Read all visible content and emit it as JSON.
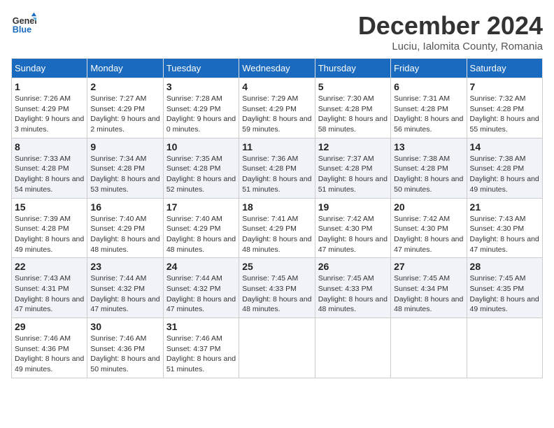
{
  "logo": {
    "line1": "General",
    "line2": "Blue"
  },
  "title": "December 2024",
  "subtitle": "Luciu, Ialomita County, Romania",
  "weekdays": [
    "Sunday",
    "Monday",
    "Tuesday",
    "Wednesday",
    "Thursday",
    "Friday",
    "Saturday"
  ],
  "weeks": [
    [
      {
        "day": "1",
        "sunrise": "7:26 AM",
        "sunset": "4:29 PM",
        "daylight": "9 hours and 3 minutes."
      },
      {
        "day": "2",
        "sunrise": "7:27 AM",
        "sunset": "4:29 PM",
        "daylight": "9 hours and 2 minutes."
      },
      {
        "day": "3",
        "sunrise": "7:28 AM",
        "sunset": "4:29 PM",
        "daylight": "9 hours and 0 minutes."
      },
      {
        "day": "4",
        "sunrise": "7:29 AM",
        "sunset": "4:29 PM",
        "daylight": "8 hours and 59 minutes."
      },
      {
        "day": "5",
        "sunrise": "7:30 AM",
        "sunset": "4:28 PM",
        "daylight": "8 hours and 58 minutes."
      },
      {
        "day": "6",
        "sunrise": "7:31 AM",
        "sunset": "4:28 PM",
        "daylight": "8 hours and 56 minutes."
      },
      {
        "day": "7",
        "sunrise": "7:32 AM",
        "sunset": "4:28 PM",
        "daylight": "8 hours and 55 minutes."
      }
    ],
    [
      {
        "day": "8",
        "sunrise": "7:33 AM",
        "sunset": "4:28 PM",
        "daylight": "8 hours and 54 minutes."
      },
      {
        "day": "9",
        "sunrise": "7:34 AM",
        "sunset": "4:28 PM",
        "daylight": "8 hours and 53 minutes."
      },
      {
        "day": "10",
        "sunrise": "7:35 AM",
        "sunset": "4:28 PM",
        "daylight": "8 hours and 52 minutes."
      },
      {
        "day": "11",
        "sunrise": "7:36 AM",
        "sunset": "4:28 PM",
        "daylight": "8 hours and 51 minutes."
      },
      {
        "day": "12",
        "sunrise": "7:37 AM",
        "sunset": "4:28 PM",
        "daylight": "8 hours and 51 minutes."
      },
      {
        "day": "13",
        "sunrise": "7:38 AM",
        "sunset": "4:28 PM",
        "daylight": "8 hours and 50 minutes."
      },
      {
        "day": "14",
        "sunrise": "7:38 AM",
        "sunset": "4:28 PM",
        "daylight": "8 hours and 49 minutes."
      }
    ],
    [
      {
        "day": "15",
        "sunrise": "7:39 AM",
        "sunset": "4:28 PM",
        "daylight": "8 hours and 49 minutes."
      },
      {
        "day": "16",
        "sunrise": "7:40 AM",
        "sunset": "4:29 PM",
        "daylight": "8 hours and 48 minutes."
      },
      {
        "day": "17",
        "sunrise": "7:40 AM",
        "sunset": "4:29 PM",
        "daylight": "8 hours and 48 minutes."
      },
      {
        "day": "18",
        "sunrise": "7:41 AM",
        "sunset": "4:29 PM",
        "daylight": "8 hours and 48 minutes."
      },
      {
        "day": "19",
        "sunrise": "7:42 AM",
        "sunset": "4:30 PM",
        "daylight": "8 hours and 47 minutes."
      },
      {
        "day": "20",
        "sunrise": "7:42 AM",
        "sunset": "4:30 PM",
        "daylight": "8 hours and 47 minutes."
      },
      {
        "day": "21",
        "sunrise": "7:43 AM",
        "sunset": "4:30 PM",
        "daylight": "8 hours and 47 minutes."
      }
    ],
    [
      {
        "day": "22",
        "sunrise": "7:43 AM",
        "sunset": "4:31 PM",
        "daylight": "8 hours and 47 minutes."
      },
      {
        "day": "23",
        "sunrise": "7:44 AM",
        "sunset": "4:32 PM",
        "daylight": "8 hours and 47 minutes."
      },
      {
        "day": "24",
        "sunrise": "7:44 AM",
        "sunset": "4:32 PM",
        "daylight": "8 hours and 47 minutes."
      },
      {
        "day": "25",
        "sunrise": "7:45 AM",
        "sunset": "4:33 PM",
        "daylight": "8 hours and 48 minutes."
      },
      {
        "day": "26",
        "sunrise": "7:45 AM",
        "sunset": "4:33 PM",
        "daylight": "8 hours and 48 minutes."
      },
      {
        "day": "27",
        "sunrise": "7:45 AM",
        "sunset": "4:34 PM",
        "daylight": "8 hours and 48 minutes."
      },
      {
        "day": "28",
        "sunrise": "7:45 AM",
        "sunset": "4:35 PM",
        "daylight": "8 hours and 49 minutes."
      }
    ],
    [
      {
        "day": "29",
        "sunrise": "7:46 AM",
        "sunset": "4:36 PM",
        "daylight": "8 hours and 49 minutes."
      },
      {
        "day": "30",
        "sunrise": "7:46 AM",
        "sunset": "4:36 PM",
        "daylight": "8 hours and 50 minutes."
      },
      {
        "day": "31",
        "sunrise": "7:46 AM",
        "sunset": "4:37 PM",
        "daylight": "8 hours and 51 minutes."
      },
      null,
      null,
      null,
      null
    ]
  ],
  "labels": {
    "sunrise": "Sunrise:",
    "sunset": "Sunset:",
    "daylight": "Daylight:"
  }
}
